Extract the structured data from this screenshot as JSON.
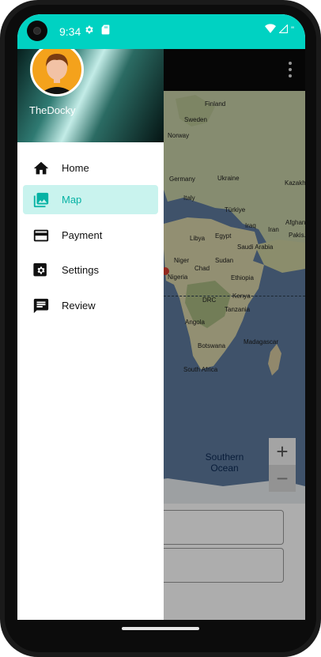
{
  "status_bar": {
    "time": "9:34",
    "left_icons": [
      "settings-icon",
      "sd-card-icon"
    ],
    "right_icons": [
      "wifi-icon",
      "signal-icon"
    ],
    "right_text": "\""
  },
  "toolbar": {
    "overflow_icon": "more-vert-icon"
  },
  "drawer": {
    "user_name": "TheDocky",
    "items": [
      {
        "label": "Home",
        "icon": "home-icon",
        "active": false
      },
      {
        "label": "Map",
        "icon": "image-icon",
        "active": true
      },
      {
        "label": "Payment",
        "icon": "credit-card-icon",
        "active": false
      },
      {
        "label": "Settings",
        "icon": "settings-icon",
        "active": false
      },
      {
        "label": "Review",
        "icon": "chat-icon",
        "active": false
      }
    ]
  },
  "map": {
    "labels": [
      "Finland",
      "Sweden",
      "Norway",
      "Germany",
      "Ukraine",
      "Italy",
      "Türkiye",
      "Iraq",
      "Iran",
      "Afghani...",
      "Pakis...",
      "Kazakh...",
      "Libya",
      "Egypt",
      "Saudi Arabia",
      "Niger",
      "Chad",
      "Sudan",
      "Nigeria",
      "Ethiopia",
      "DRC",
      "Kenya",
      "Tanzania",
      "Angola",
      "Botswana",
      "Madagascar",
      "South Africa"
    ],
    "ocean_label_line1": "Southern",
    "ocean_label_line2": "Ocean",
    "zoom_in": "+",
    "zoom_out": "−"
  },
  "colors": {
    "accent": "#00d2c2",
    "active_bg": "#c9f3ee",
    "active_text": "#06b2a4"
  }
}
